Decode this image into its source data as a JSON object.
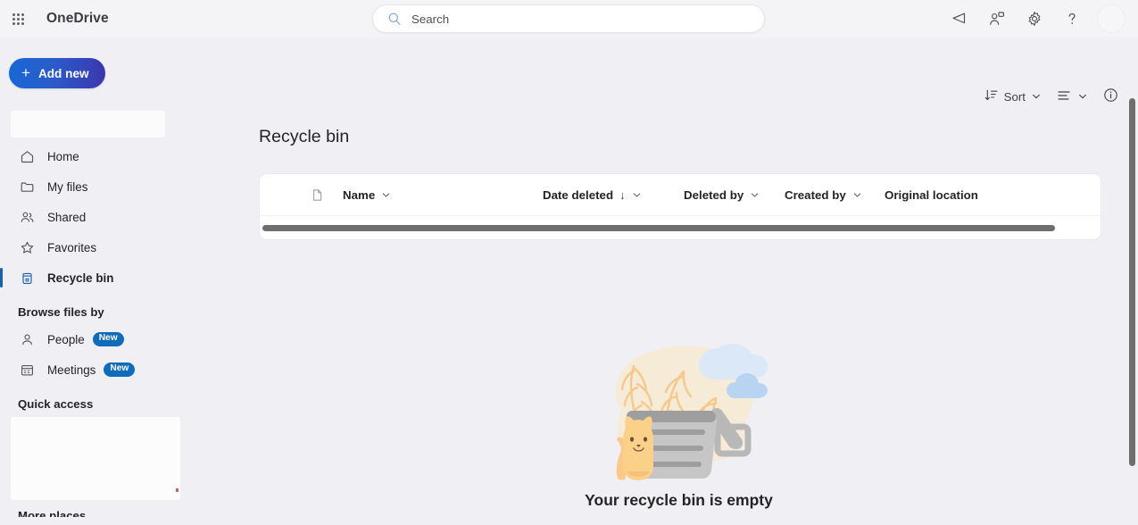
{
  "suitebar": {
    "waffle_label": "App launcher",
    "brand": "OneDrive",
    "search": {
      "placeholder": "Search",
      "value": "Search"
    },
    "actions": [
      {
        "name": "feedback-icon",
        "label": "Feedback"
      },
      {
        "name": "meet-now-icon",
        "label": "Meet now"
      },
      {
        "name": "settings-gear-icon",
        "label": "Settings"
      },
      {
        "name": "help-icon",
        "label": "Help"
      }
    ],
    "avatar_label": "Account manager"
  },
  "commandbar": {
    "add_new_label": "Add new",
    "add_new_plus": "+",
    "sort_label": "Sort",
    "view_label": "View options",
    "details_label": "Details"
  },
  "sidebar": {
    "items": [
      {
        "label": "Home",
        "icon": "home-icon",
        "selected": false
      },
      {
        "label": "My files",
        "icon": "folder-icon",
        "selected": false
      },
      {
        "label": "Shared",
        "icon": "people-icon",
        "selected": false
      },
      {
        "label": "Favorites",
        "icon": "star-icon",
        "selected": false
      },
      {
        "label": "Recycle bin",
        "icon": "recycle-bin-icon",
        "selected": true
      }
    ],
    "browse_title": "Browse files by",
    "browse_items": [
      {
        "label": "People",
        "icon": "person-icon",
        "badge": "New"
      },
      {
        "label": "Meetings",
        "icon": "calendar-icon",
        "badge": "New"
      }
    ],
    "quick_access_title": "Quick access",
    "more_places_title": "More places"
  },
  "main": {
    "title": "Recycle bin",
    "columns": [
      {
        "label": "Name",
        "sorted": false,
        "has_chevron": true
      },
      {
        "label": "Date deleted",
        "sorted": true,
        "sort_arrow": "↓",
        "has_chevron": true
      },
      {
        "label": "Deleted by",
        "sorted": false,
        "has_chevron": true
      },
      {
        "label": "Created by",
        "sorted": false,
        "has_chevron": true
      },
      {
        "label": "Original location",
        "sorted": false,
        "has_chevron": false
      }
    ],
    "empty_message": "Your recycle bin is empty"
  },
  "colors": {
    "accent_blue": "#1560b3",
    "badge_blue": "#0f6cbd",
    "page_bg": "#f0f0f4",
    "card_bg": "#ffffff",
    "scrollbar": "#6e6e6e"
  }
}
